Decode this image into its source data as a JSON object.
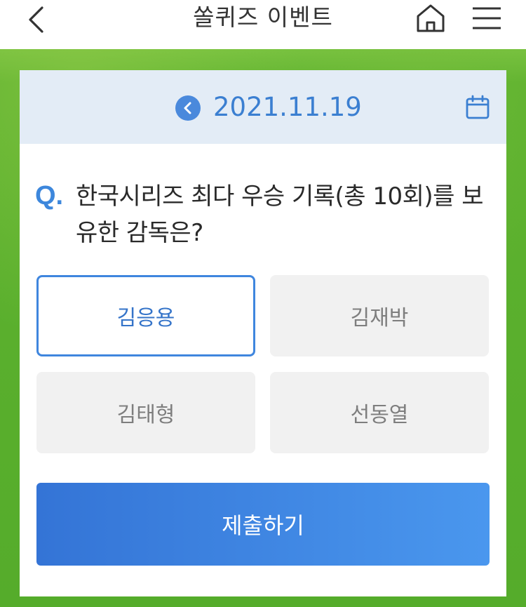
{
  "header": {
    "title": "쏠퀴즈 이벤트",
    "back_icon": "chevron-left-icon",
    "home_icon": "home-icon",
    "menu_icon": "hamburger-menu-icon"
  },
  "date_bar": {
    "date": "2021.11.19",
    "prev_icon": "chevron-left-circle-icon",
    "calendar_icon": "calendar-icon"
  },
  "quiz": {
    "q_prefix": "Q.",
    "question": "한국시리즈 최다 우승 기록(총 10회)를 보유한 감독은?",
    "options": [
      {
        "label": "김응용",
        "selected": true
      },
      {
        "label": "김재박",
        "selected": false
      },
      {
        "label": "김태형",
        "selected": false
      },
      {
        "label": "선동열",
        "selected": false
      }
    ],
    "submit_label": "제출하기"
  },
  "colors": {
    "accent": "#3f86de",
    "background_green": "#5fb332",
    "date_bar_bg": "#e3ecf6"
  }
}
